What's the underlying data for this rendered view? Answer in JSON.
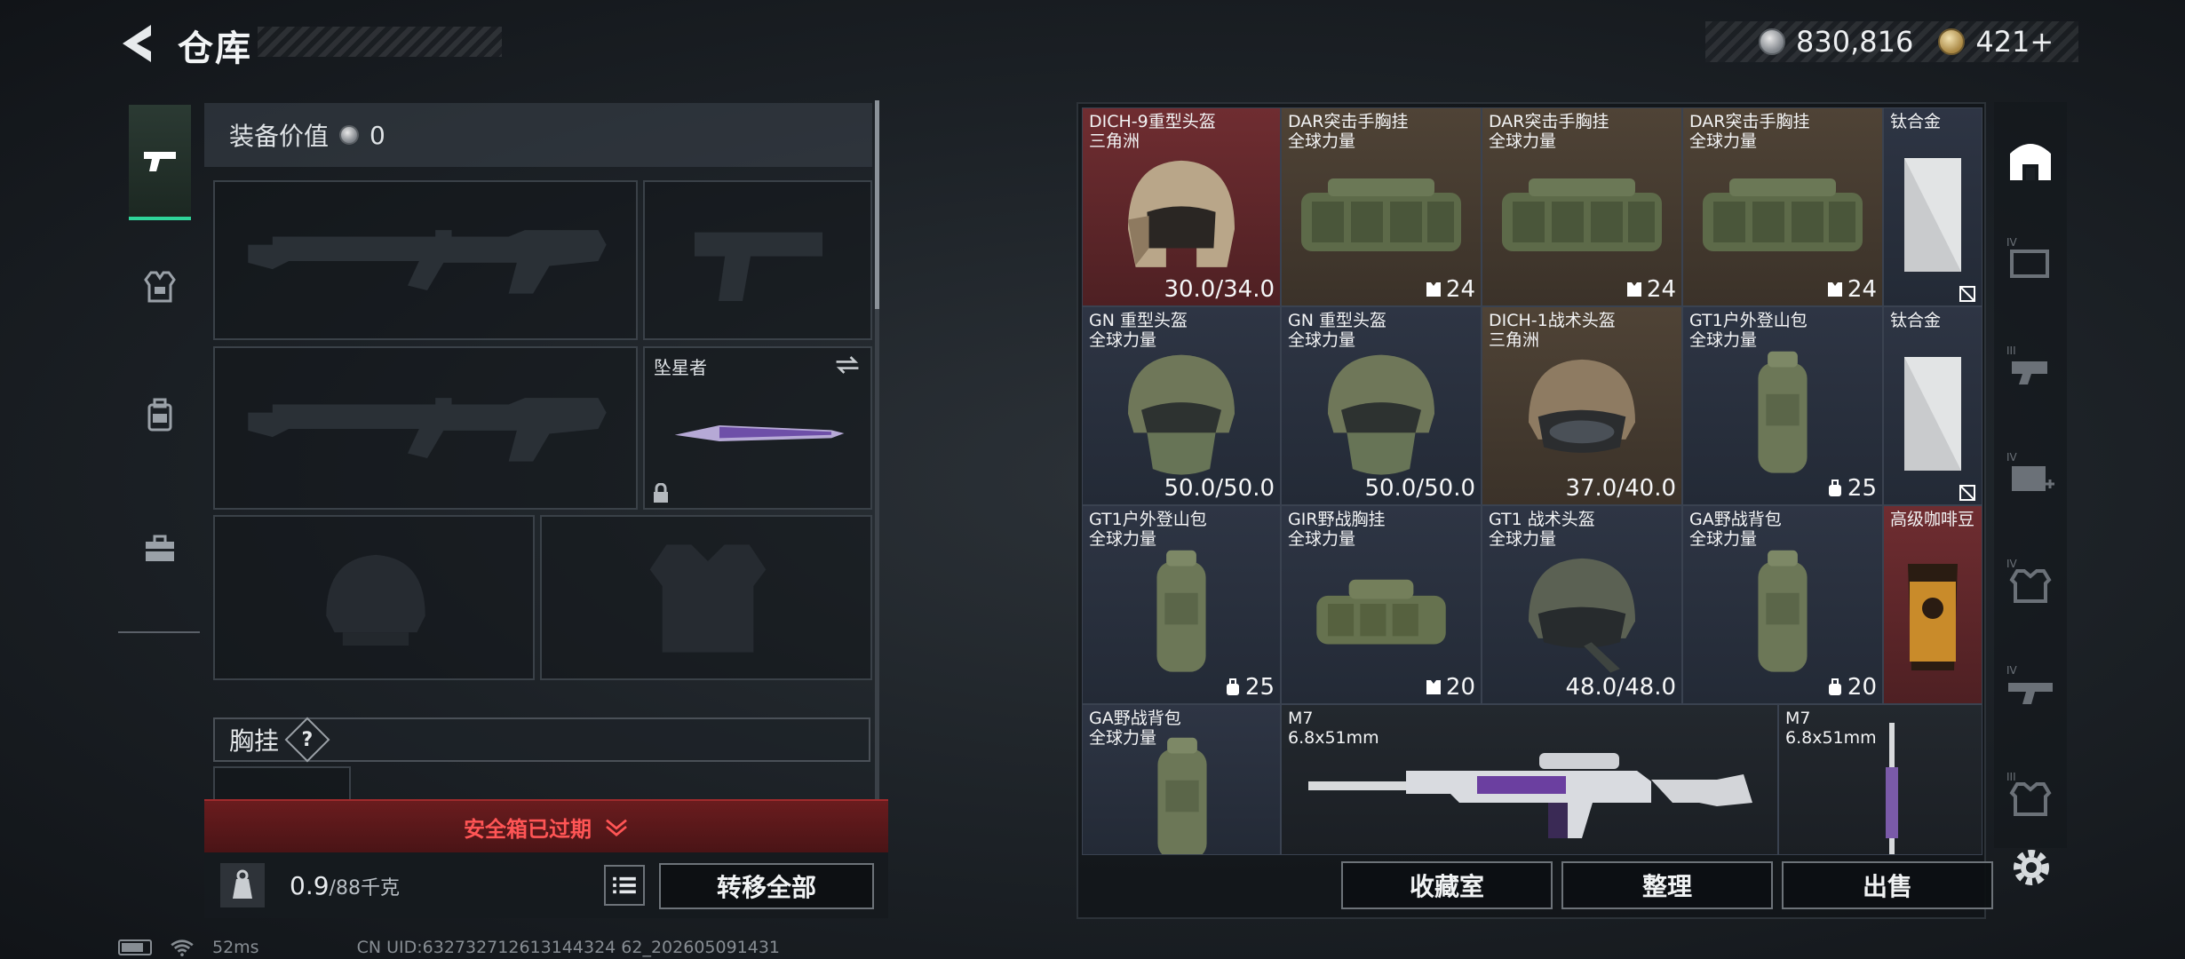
{
  "header": {
    "title": "仓库",
    "currency_silver": "830,816",
    "currency_gold": "421+"
  },
  "loadout": {
    "equip_value_label": "装备价值",
    "equip_value": "0",
    "melee_name": "坠星者",
    "chest_label": "胸挂",
    "help_label": "?",
    "safe_box_status": "安全箱已过期",
    "weight_value": "0.9",
    "weight_max": "/88千克",
    "transfer_all": "转移全部"
  },
  "stash": {
    "items": [
      {
        "name": "DICH-9重型头盔",
        "sub": "三角洲",
        "stat": "30.0/34.0",
        "icon": "helmet-icon"
      },
      {
        "name": "DAR突击手胸挂",
        "sub": "全球力量",
        "stat": "24",
        "icon": "vest-icon"
      },
      {
        "name": "DAR突击手胸挂",
        "sub": "全球力量",
        "stat": "24",
        "icon": "vest-icon"
      },
      {
        "name": "DAR突击手胸挂",
        "sub": "全球力量",
        "stat": "24",
        "icon": "vest-icon"
      },
      {
        "name": "钛合金",
        "sub": "",
        "stat": "",
        "icon": "titanium-icon"
      },
      {
        "name": "GN 重型头盔",
        "sub": "全球力量",
        "stat": "50.0/50.0",
        "icon": "helmet-icon"
      },
      {
        "name": "GN 重型头盔",
        "sub": "全球力量",
        "stat": "50.0/50.0",
        "icon": "helmet-icon"
      },
      {
        "name": "DICH-1战术头盔",
        "sub": "三角洲",
        "stat": "37.0/40.0",
        "icon": "helmet-icon"
      },
      {
        "name": "GT1户外登山包",
        "sub": "全球力量",
        "stat": "25",
        "icon": "backpack-icon"
      },
      {
        "name": "钛合金",
        "sub": "",
        "stat": "",
        "icon": "titanium-icon"
      },
      {
        "name": "GT1户外登山包",
        "sub": "全球力量",
        "stat": "25",
        "icon": "backpack-icon"
      },
      {
        "name": "GIR野战胸挂",
        "sub": "全球力量",
        "stat": "20",
        "icon": "vest-icon"
      },
      {
        "name": "GT1 战术头盔",
        "sub": "全球力量",
        "stat": "48.0/48.0",
        "icon": "helmet-icon"
      },
      {
        "name": "GA野战背包",
        "sub": "全球力量",
        "stat": "20",
        "icon": "backpack-icon"
      },
      {
        "name": "高级咖啡豆",
        "sub": "",
        "stat": "",
        "icon": "coffee-icon"
      },
      {
        "name": "GA野战背包",
        "sub": "全球力量",
        "stat": "",
        "icon": "backpack-icon"
      },
      {
        "name": "M7",
        "sub": "6.8x51mm",
        "stat": "",
        "icon": "rifle-icon"
      },
      {
        "name": "M7",
        "sub": "6.8x51mm",
        "stat": "",
        "icon": "rifle-icon"
      }
    ],
    "buttons": {
      "collection": "收藏室",
      "organize": "整理",
      "sell": "出售"
    }
  },
  "status_bar": {
    "ping": "52ms",
    "uid": "CN UID:632732712613144324 62_202605091431"
  },
  "colors": {
    "accent": "#2fd59a",
    "warning": "#ff5555",
    "rarity_red": "#6f2d31",
    "rarity_gold": "#4f4336",
    "rarity_blue": "#2e3544"
  }
}
